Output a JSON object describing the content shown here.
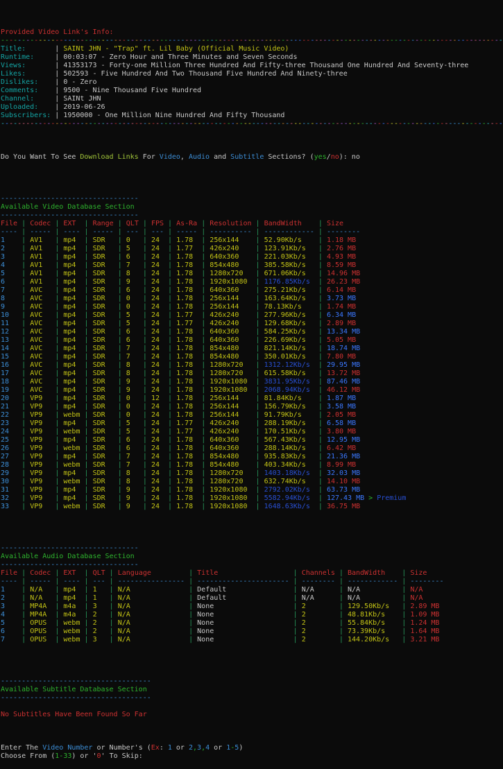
{
  "palette": {
    "white": "#c9c9c9",
    "red": "#cd3131",
    "yellow": "#c4c416",
    "green": "#2eb42e",
    "lime": "#a2c63a",
    "cyan": "#14a5a5",
    "blue": "#3d8fd8",
    "brightblue": "#3b78ff",
    "darkblue": "#2950d5",
    "pipe": "#27995c"
  },
  "rainbow_palette": [
    "#9b59d0",
    "#3b78ff",
    "#2bb3c0",
    "#d4607a",
    "#c9c92a",
    "#2fb830",
    "#cd3131",
    "#cf8a2e",
    "#3a96dd",
    "#b153c7"
  ],
  "info_header": {
    "title": "Provided Video Link's Info:",
    "rows": [
      {
        "label": "Title:",
        "value": "SAINt JHN - \"Trap\" ft. Lil Baby (Official Music Video)",
        "value_color": "yellow"
      },
      {
        "label": "Runtime:",
        "value": "00:03:07 - Zero Hour and Three Minutes and Seven Seconds",
        "value_color": "white"
      },
      {
        "label": "Views:",
        "value": "41353173 - Forty-one Million Three Hundred And Fifty-three Thousand One Hundred And Seventy-three",
        "value_color": "white"
      },
      {
        "label": "Likes:",
        "value": "502593 - Five Hundred And Two Thousand Five Hundred And Ninety-three",
        "value_color": "white"
      },
      {
        "label": "Dislikes:",
        "value": "0 - Zero",
        "value_color": "white"
      },
      {
        "label": "Comments:",
        "value": "9500 - Nine Thousand Five Hundred",
        "value_color": "white"
      },
      {
        "label": "Channel:",
        "value": "SAINt JHN",
        "value_color": "white"
      },
      {
        "label": "Uploaded:",
        "value": "2019-06-26",
        "value_color": "white"
      },
      {
        "label": "Subscribers:",
        "value": "1950000 - One Million Nine Hundred And Fifty Thousand",
        "value_color": "white"
      }
    ]
  },
  "download_prompt": [
    {
      "t": "Do You Want To See ",
      "c": "white"
    },
    {
      "t": "Download Links",
      "c": "lime"
    },
    {
      "t": " For ",
      "c": "white"
    },
    {
      "t": "Video",
      "c": "blue"
    },
    {
      "t": ", ",
      "c": "white"
    },
    {
      "t": "Audio",
      "c": "blue"
    },
    {
      "t": " and ",
      "c": "white"
    },
    {
      "t": "Subtitle",
      "c": "blue"
    },
    {
      "t": " Sections? (",
      "c": "white"
    },
    {
      "t": "yes",
      "c": "green"
    },
    {
      "t": "/",
      "c": "white"
    },
    {
      "t": "no",
      "c": "red"
    },
    {
      "t": "): no",
      "c": "white"
    }
  ],
  "video_section": {
    "separator_len": 33,
    "title": "Available Video Database Section",
    "columns": [
      "File",
      "Codec",
      "EXT",
      "Range",
      "QLT",
      "FPS",
      "As-Ra",
      "Resolution",
      "BandWidth",
      "Size"
    ],
    "widths": [
      4,
      5,
      4,
      5,
      3,
      3,
      5,
      10,
      12,
      8
    ],
    "rows": [
      {
        "file": "1",
        "codec": "AV1",
        "ext": "mp4",
        "range": "SDR",
        "qlt": "0",
        "fps": "24",
        "ar": "1.78",
        "res": "256x144",
        "bw": "52.90Kb/s",
        "bwc": "yellow",
        "size": "1.18 MB",
        "sizec": "red"
      },
      {
        "file": "2",
        "codec": "AV1",
        "ext": "mp4",
        "range": "SDR",
        "qlt": "5",
        "fps": "24",
        "ar": "1.77",
        "res": "426x240",
        "bw": "123.91Kb/s",
        "bwc": "yellow",
        "size": "2.76 MB",
        "sizec": "red"
      },
      {
        "file": "3",
        "codec": "AV1",
        "ext": "mp4",
        "range": "SDR",
        "qlt": "6",
        "fps": "24",
        "ar": "1.78",
        "res": "640x360",
        "bw": "221.03Kb/s",
        "bwc": "yellow",
        "size": "4.93 MB",
        "sizec": "red"
      },
      {
        "file": "4",
        "codec": "AV1",
        "ext": "mp4",
        "range": "SDR",
        "qlt": "7",
        "fps": "24",
        "ar": "1.78",
        "res": "854x480",
        "bw": "385.58Kb/s",
        "bwc": "yellow",
        "size": "8.59 MB",
        "sizec": "red"
      },
      {
        "file": "5",
        "codec": "AV1",
        "ext": "mp4",
        "range": "SDR",
        "qlt": "8",
        "fps": "24",
        "ar": "1.78",
        "res": "1280x720",
        "bw": "671.06Kb/s",
        "bwc": "yellow",
        "size": "14.96 MB",
        "sizec": "red"
      },
      {
        "file": "6",
        "codec": "AV1",
        "ext": "mp4",
        "range": "SDR",
        "qlt": "9",
        "fps": "24",
        "ar": "1.78",
        "res": "1920x1080",
        "bw": "1176.85Kb/s",
        "bwc": "darkblue",
        "size": "26.23 MB",
        "sizec": "red"
      },
      {
        "file": "7",
        "codec": "AVC",
        "ext": "mp4",
        "range": "SDR",
        "qlt": "6",
        "fps": "24",
        "ar": "1.78",
        "res": "640x360",
        "bw": "275.21Kb/s",
        "bwc": "yellow",
        "size": "6.14 MB",
        "sizec": "red"
      },
      {
        "file": "8",
        "codec": "AVC",
        "ext": "mp4",
        "range": "SDR",
        "qlt": "0",
        "fps": "24",
        "ar": "1.78",
        "res": "256x144",
        "bw": "163.64Kb/s",
        "bwc": "yellow",
        "size": "3.73 MB",
        "sizec": "brightblue"
      },
      {
        "file": "9",
        "codec": "AVC",
        "ext": "mp4",
        "range": "SDR",
        "qlt": "0",
        "fps": "24",
        "ar": "1.78",
        "res": "256x144",
        "bw": "78.13Kb/s",
        "bwc": "yellow",
        "size": "1.74 MB",
        "sizec": "red"
      },
      {
        "file": "10",
        "codec": "AVC",
        "ext": "mp4",
        "range": "SDR",
        "qlt": "5",
        "fps": "24",
        "ar": "1.77",
        "res": "426x240",
        "bw": "277.96Kb/s",
        "bwc": "yellow",
        "size": "6.34 MB",
        "sizec": "brightblue"
      },
      {
        "file": "11",
        "codec": "AVC",
        "ext": "mp4",
        "range": "SDR",
        "qlt": "5",
        "fps": "24",
        "ar": "1.77",
        "res": "426x240",
        "bw": "129.68Kb/s",
        "bwc": "yellow",
        "size": "2.89 MB",
        "sizec": "red"
      },
      {
        "file": "12",
        "codec": "AVC",
        "ext": "mp4",
        "range": "SDR",
        "qlt": "6",
        "fps": "24",
        "ar": "1.78",
        "res": "640x360",
        "bw": "584.25Kb/s",
        "bwc": "yellow",
        "size": "13.34 MB",
        "sizec": "brightblue"
      },
      {
        "file": "13",
        "codec": "AVC",
        "ext": "mp4",
        "range": "SDR",
        "qlt": "6",
        "fps": "24",
        "ar": "1.78",
        "res": "640x360",
        "bw": "226.69Kb/s",
        "bwc": "yellow",
        "size": "5.05 MB",
        "sizec": "red"
      },
      {
        "file": "14",
        "codec": "AVC",
        "ext": "mp4",
        "range": "SDR",
        "qlt": "7",
        "fps": "24",
        "ar": "1.78",
        "res": "854x480",
        "bw": "821.14Kb/s",
        "bwc": "yellow",
        "size": "18.74 MB",
        "sizec": "brightblue"
      },
      {
        "file": "15",
        "codec": "AVC",
        "ext": "mp4",
        "range": "SDR",
        "qlt": "7",
        "fps": "24",
        "ar": "1.78",
        "res": "854x480",
        "bw": "350.01Kb/s",
        "bwc": "yellow",
        "size": "7.80 MB",
        "sizec": "red"
      },
      {
        "file": "16",
        "codec": "AVC",
        "ext": "mp4",
        "range": "SDR",
        "qlt": "8",
        "fps": "24",
        "ar": "1.78",
        "res": "1280x720",
        "bw": "1312.12Kb/s",
        "bwc": "darkblue",
        "size": "29.95 MB",
        "sizec": "brightblue"
      },
      {
        "file": "17",
        "codec": "AVC",
        "ext": "mp4",
        "range": "SDR",
        "qlt": "8",
        "fps": "24",
        "ar": "1.78",
        "res": "1280x720",
        "bw": "615.58Kb/s",
        "bwc": "yellow",
        "size": "13.72 MB",
        "sizec": "red"
      },
      {
        "file": "18",
        "codec": "AVC",
        "ext": "mp4",
        "range": "SDR",
        "qlt": "9",
        "fps": "24",
        "ar": "1.78",
        "res": "1920x1080",
        "bw": "3831.95Kb/s",
        "bwc": "darkblue",
        "size": "87.46 MB",
        "sizec": "brightblue"
      },
      {
        "file": "19",
        "codec": "AVC",
        "ext": "mp4",
        "range": "SDR",
        "qlt": "9",
        "fps": "24",
        "ar": "1.78",
        "res": "1920x1080",
        "bw": "2068.94Kb/s",
        "bwc": "darkblue",
        "size": "46.12 MB",
        "sizec": "red"
      },
      {
        "file": "20",
        "codec": "VP9",
        "ext": "mp4",
        "range": "SDR",
        "qlt": "0",
        "fps": "12",
        "ar": "1.78",
        "res": "256x144",
        "bw": "81.84Kb/s",
        "bwc": "yellow",
        "size": "1.87 MB",
        "sizec": "brightblue"
      },
      {
        "file": "21",
        "codec": "VP9",
        "ext": "mp4",
        "range": "SDR",
        "qlt": "0",
        "fps": "24",
        "ar": "1.78",
        "res": "256x144",
        "bw": "156.79Kb/s",
        "bwc": "yellow",
        "size": "3.58 MB",
        "sizec": "brightblue"
      },
      {
        "file": "22",
        "codec": "VP9",
        "ext": "webm",
        "range": "SDR",
        "qlt": "0",
        "fps": "24",
        "ar": "1.78",
        "res": "256x144",
        "bw": "91.79Kb/s",
        "bwc": "yellow",
        "size": "2.05 MB",
        "sizec": "red"
      },
      {
        "file": "23",
        "codec": "VP9",
        "ext": "mp4",
        "range": "SDR",
        "qlt": "5",
        "fps": "24",
        "ar": "1.77",
        "res": "426x240",
        "bw": "288.19Kb/s",
        "bwc": "yellow",
        "size": "6.58 MB",
        "sizec": "brightblue"
      },
      {
        "file": "24",
        "codec": "VP9",
        "ext": "webm",
        "range": "SDR",
        "qlt": "5",
        "fps": "24",
        "ar": "1.77",
        "res": "426x240",
        "bw": "170.51Kb/s",
        "bwc": "yellow",
        "size": "3.80 MB",
        "sizec": "red"
      },
      {
        "file": "25",
        "codec": "VP9",
        "ext": "mp4",
        "range": "SDR",
        "qlt": "6",
        "fps": "24",
        "ar": "1.78",
        "res": "640x360",
        "bw": "567.43Kb/s",
        "bwc": "yellow",
        "size": "12.95 MB",
        "sizec": "brightblue"
      },
      {
        "file": "26",
        "codec": "VP9",
        "ext": "webm",
        "range": "SDR",
        "qlt": "6",
        "fps": "24",
        "ar": "1.78",
        "res": "640x360",
        "bw": "288.14Kb/s",
        "bwc": "yellow",
        "size": "6.42 MB",
        "sizec": "red"
      },
      {
        "file": "27",
        "codec": "VP9",
        "ext": "mp4",
        "range": "SDR",
        "qlt": "7",
        "fps": "24",
        "ar": "1.78",
        "res": "854x480",
        "bw": "935.83Kb/s",
        "bwc": "yellow",
        "size": "21.36 MB",
        "sizec": "brightblue"
      },
      {
        "file": "28",
        "codec": "VP9",
        "ext": "webm",
        "range": "SDR",
        "qlt": "7",
        "fps": "24",
        "ar": "1.78",
        "res": "854x480",
        "bw": "403.34Kb/s",
        "bwc": "yellow",
        "size": "8.99 MB",
        "sizec": "red"
      },
      {
        "file": "29",
        "codec": "VP9",
        "ext": "mp4",
        "range": "SDR",
        "qlt": "8",
        "fps": "24",
        "ar": "1.78",
        "res": "1280x720",
        "bw": "1403.18Kb/s",
        "bwc": "darkblue",
        "size": "32.03 MB",
        "sizec": "brightblue"
      },
      {
        "file": "30",
        "codec": "VP9",
        "ext": "webm",
        "range": "SDR",
        "qlt": "8",
        "fps": "24",
        "ar": "1.78",
        "res": "1280x720",
        "bw": "632.74Kb/s",
        "bwc": "yellow",
        "size": "14.10 MB",
        "sizec": "red"
      },
      {
        "file": "31",
        "codec": "VP9",
        "ext": "mp4",
        "range": "SDR",
        "qlt": "9",
        "fps": "24",
        "ar": "1.78",
        "res": "1920x1080",
        "bw": "2792.02Kb/s",
        "bwc": "darkblue",
        "size": "63.73 MB",
        "sizec": "brightblue"
      },
      {
        "file": "32",
        "codec": "VP9",
        "ext": "mp4",
        "range": "SDR",
        "qlt": "9",
        "fps": "24",
        "ar": "1.78",
        "res": "1920x1080",
        "bw": "5582.94Kb/s",
        "bwc": "darkblue",
        "size": "127.43 MB",
        "sizec": "brightblue",
        "extra": [
          {
            "t": " > ",
            "c": "green"
          },
          {
            "t": "Premium",
            "c": "darkblue"
          }
        ]
      },
      {
        "file": "33",
        "codec": "VP9",
        "ext": "webm",
        "range": "SDR",
        "qlt": "9",
        "fps": "24",
        "ar": "1.78",
        "res": "1920x1080",
        "bw": "1648.63Kb/s",
        "bwc": "darkblue",
        "size": "36.75 MB",
        "sizec": "red"
      }
    ]
  },
  "audio_section": {
    "separator_len": 33,
    "title": "Available Audio Database Section",
    "columns": [
      "File",
      "Codec",
      "EXT",
      "QLT",
      "Language",
      "Title",
      "Channels",
      "BandWidth",
      "Size"
    ],
    "widths": [
      4,
      5,
      4,
      3,
      16,
      22,
      8,
      12,
      8
    ],
    "rows": [
      {
        "file": "1",
        "codec": "N/A",
        "ext": "mp4",
        "qlt": "1",
        "lang": "N/A",
        "title": "Default",
        "ch": "N/A",
        "bw": "N/A",
        "size": "N/A"
      },
      {
        "file": "2",
        "codec": "N/A",
        "ext": "mp4",
        "qlt": "1",
        "lang": "N/A",
        "title": "Default",
        "ch": "N/A",
        "bw": "N/A",
        "size": "N/A"
      },
      {
        "file": "3",
        "codec": "MP4A",
        "ext": "m4a",
        "qlt": "3",
        "lang": "N/A",
        "title": "None",
        "ch": "2",
        "bw": "129.50Kb/s",
        "size": "2.89 MB"
      },
      {
        "file": "4",
        "codec": "MP4A",
        "ext": "m4a",
        "qlt": "2",
        "lang": "N/A",
        "title": "None",
        "ch": "2",
        "bw": "48.81Kb/s",
        "size": "1.09 MB"
      },
      {
        "file": "5",
        "codec": "OPUS",
        "ext": "webm",
        "qlt": "2",
        "lang": "N/A",
        "title": "None",
        "ch": "2",
        "bw": "55.84Kb/s",
        "size": "1.24 MB"
      },
      {
        "file": "6",
        "codec": "OPUS",
        "ext": "webm",
        "qlt": "2",
        "lang": "N/A",
        "title": "None",
        "ch": "2",
        "bw": "73.39Kb/s",
        "size": "1.64 MB"
      },
      {
        "file": "7",
        "codec": "OPUS",
        "ext": "webm",
        "qlt": "3",
        "lang": "N/A",
        "title": "None",
        "ch": "2",
        "bw": "144.20Kb/s",
        "size": "3.21 MB"
      }
    ]
  },
  "subtitle_section": {
    "separator_len": 36,
    "title": "Available Subtitle Database Section",
    "message": "No Subtitles Have Been Found So Far"
  },
  "footer": {
    "enter_line": [
      {
        "t": "Enter The ",
        "c": "white"
      },
      {
        "t": "Video Number",
        "c": "blue"
      },
      {
        "t": " or Number's (",
        "c": "white"
      },
      {
        "t": "Ex",
        "c": "red"
      },
      {
        "t": ": ",
        "c": "white"
      },
      {
        "t": "1",
        "c": "blue"
      },
      {
        "t": " or ",
        "c": "white"
      },
      {
        "t": "2",
        "c": "blue"
      },
      {
        "t": ",",
        "c": "green"
      },
      {
        "t": "3",
        "c": "blue"
      },
      {
        "t": ",",
        "c": "green"
      },
      {
        "t": "4",
        "c": "blue"
      },
      {
        "t": " or ",
        "c": "white"
      },
      {
        "t": "1",
        "c": "blue"
      },
      {
        "t": "-",
        "c": "green"
      },
      {
        "t": "5",
        "c": "blue"
      },
      {
        "t": ")",
        "c": "white"
      }
    ],
    "choose_line": [
      {
        "t": "Choose From (",
        "c": "white"
      },
      {
        "t": "1-33",
        "c": "green"
      },
      {
        "t": ") or '",
        "c": "white"
      },
      {
        "t": "0",
        "c": "red"
      },
      {
        "t": "' To Skip:",
        "c": "white"
      }
    ]
  }
}
